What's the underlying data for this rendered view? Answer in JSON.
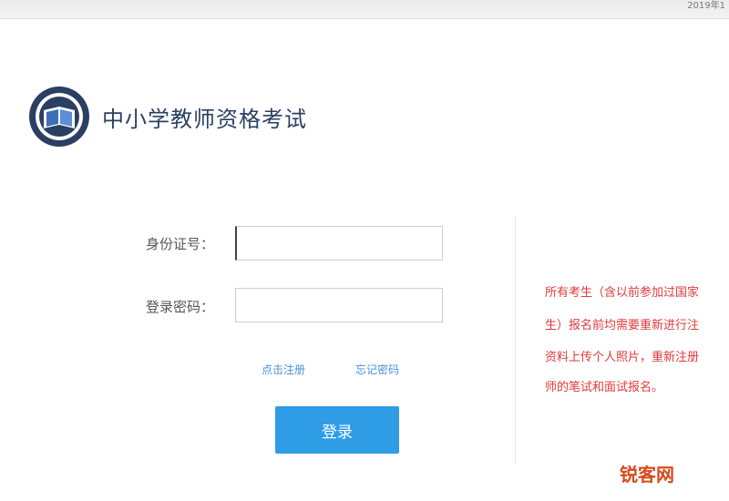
{
  "top_bar": {
    "right_text": "2019年1"
  },
  "header": {
    "title": "中小学教师资格考试"
  },
  "form": {
    "id_label": "身份证号：",
    "id_value": "",
    "password_label": "登录密码：",
    "password_value": "",
    "register_link": "点击注册",
    "forgot_link": "忘记密码",
    "login_button": "登录"
  },
  "notice": {
    "lines": [
      "所有考生（含以前参加过国家",
      "生）报名前均需要重新进行注",
      "资料上传个人照片，重新注册",
      "师的笔试和面试报名。"
    ]
  },
  "watermark": "锐客网",
  "colors": {
    "brand": "#2b3f63",
    "button": "#2e9de6",
    "notice": "#e03a3a",
    "link": "#4a90d9"
  }
}
